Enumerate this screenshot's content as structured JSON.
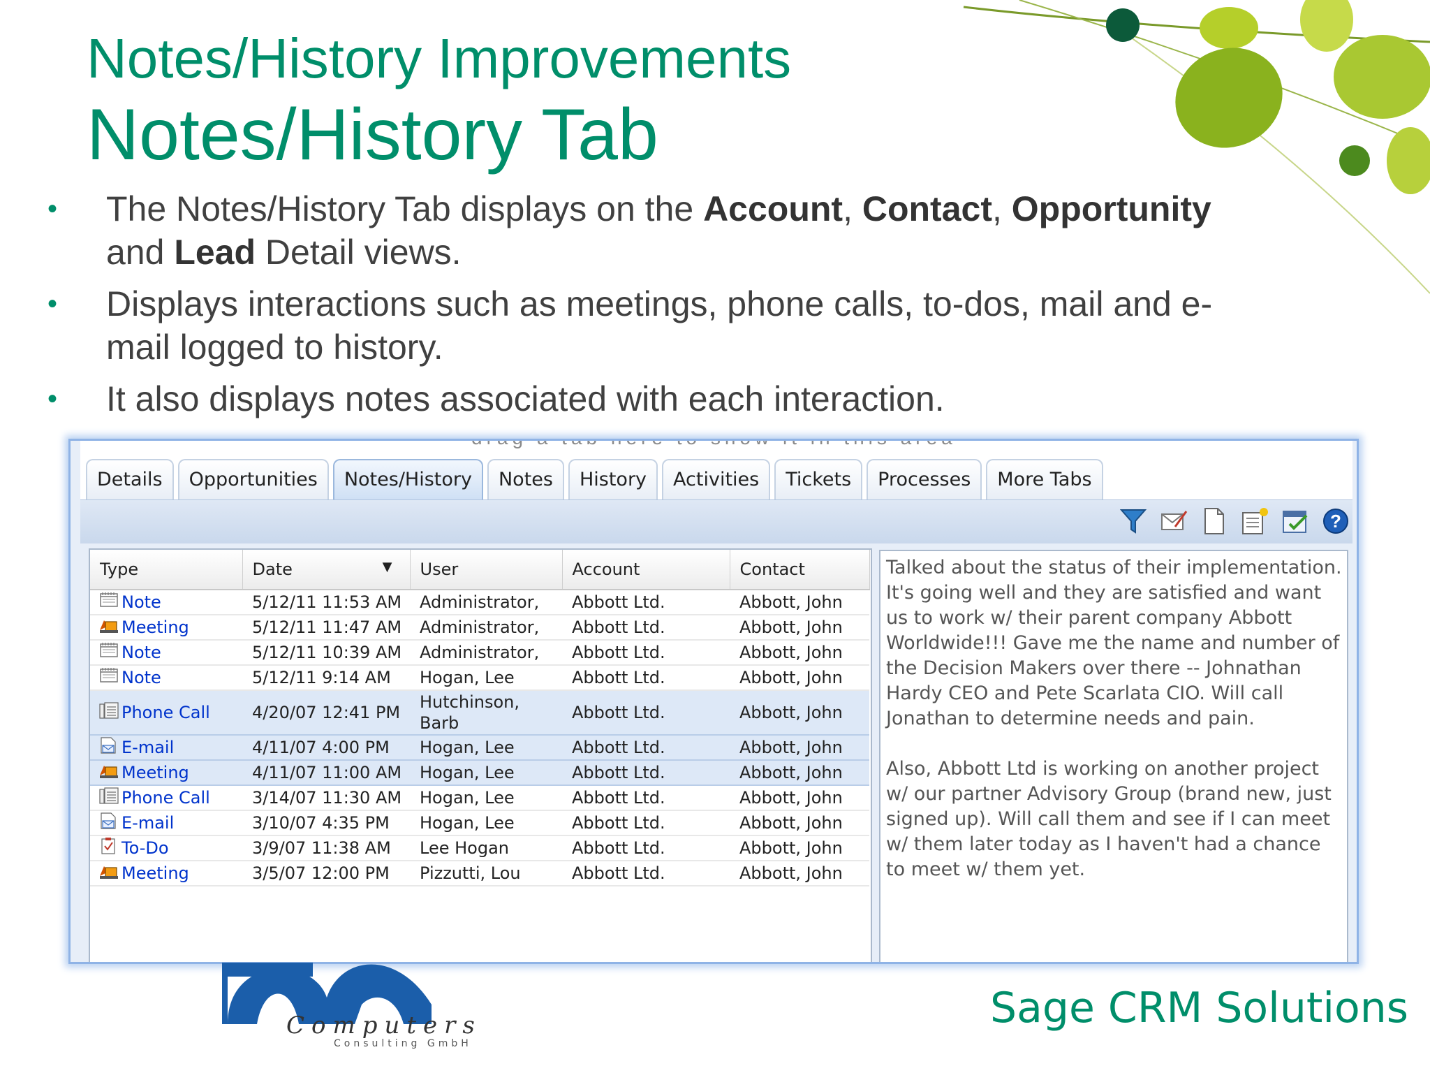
{
  "slide": {
    "title": "Notes/History Improvements",
    "subtitle": "Notes/History Tab",
    "bullets": [
      {
        "parts": [
          {
            "text": "The Notes/History Tab displays on the ",
            "bold": false
          },
          {
            "text": "Account",
            "bold": true
          },
          {
            "text": ", ",
            "bold": false
          },
          {
            "text": "Contact",
            "bold": true
          },
          {
            "text": ", ",
            "bold": false
          },
          {
            "text": "Opportunity",
            "bold": true
          },
          {
            "text": " and ",
            "bold": false
          },
          {
            "text": "Lead",
            "bold": true
          },
          {
            "text": " Detail views.",
            "bold": false
          }
        ]
      },
      {
        "parts": [
          {
            "text": "Displays interactions such as meetings, phone calls, to-dos, mail and e-mail logged to history.",
            "bold": false
          }
        ]
      },
      {
        "parts": [
          {
            "text": "It also displays notes associated with each interaction.",
            "bold": false
          }
        ]
      }
    ],
    "bullet_symbol": "•"
  },
  "crm": {
    "drag_hint": "drag a tab here to show it in this area",
    "tabs": [
      {
        "label": "Details",
        "active": false
      },
      {
        "label": "Opportunities",
        "active": false
      },
      {
        "label": "Notes/History",
        "active": true
      },
      {
        "label": "Notes",
        "active": false
      },
      {
        "label": "History",
        "active": false
      },
      {
        "label": "Activities",
        "active": false
      },
      {
        "label": "Tickets",
        "active": false
      },
      {
        "label": "Processes",
        "active": false
      },
      {
        "label": "More Tabs",
        "active": false
      }
    ],
    "toolbar_icons": [
      "filter-icon",
      "mark-mail-icon",
      "new-document-icon",
      "new-note-icon",
      "calendar-check-icon",
      "help-icon"
    ],
    "grid": {
      "columns": [
        "Type",
        "Date",
        "User",
        "Account",
        "Contact"
      ],
      "sorted_column": "Date",
      "rows": [
        {
          "type": "Note",
          "icon": "note-icon",
          "date": "5/12/11 11:53 AM",
          "user": "Administrator,",
          "account": "Abbott Ltd.",
          "contact": "Abbott, John",
          "selected": false
        },
        {
          "type": "Meeting",
          "icon": "meeting-icon",
          "date": "5/12/11 11:47 AM",
          "user": "Administrator,",
          "account": "Abbott Ltd.",
          "contact": "Abbott, John",
          "selected": false
        },
        {
          "type": "Note",
          "icon": "note-icon",
          "date": "5/12/11 10:39 AM",
          "user": "Administrator,",
          "account": "Abbott Ltd.",
          "contact": "Abbott, John",
          "selected": false
        },
        {
          "type": "Note",
          "icon": "note-icon",
          "date": "5/12/11 9:14 AM",
          "user": "Hogan, Lee",
          "account": "Abbott Ltd.",
          "contact": "Abbott, John",
          "selected": false
        },
        {
          "type": "Phone Call",
          "icon": "phone-icon",
          "date": "4/20/07 12:41 PM",
          "user": "Hutchinson, Barb",
          "account": "Abbott Ltd.",
          "contact": "Abbott, John",
          "selected": true
        },
        {
          "type": "E-mail",
          "icon": "email-icon",
          "date": "4/11/07 4:00 PM",
          "user": "Hogan, Lee",
          "account": "Abbott Ltd.",
          "contact": "Abbott, John",
          "selected": true
        },
        {
          "type": "Meeting",
          "icon": "meeting-icon",
          "date": "4/11/07 11:00 AM",
          "user": "Hogan, Lee",
          "account": "Abbott Ltd.",
          "contact": "Abbott, John",
          "selected": true
        },
        {
          "type": "Phone Call",
          "icon": "phone-icon",
          "date": "3/14/07 11:30 AM",
          "user": "Hogan, Lee",
          "account": "Abbott Ltd.",
          "contact": "Abbott, John",
          "selected": false
        },
        {
          "type": "E-mail",
          "icon": "email-icon",
          "date": "3/10/07 4:35 PM",
          "user": "Hogan, Lee",
          "account": "Abbott Ltd.",
          "contact": "Abbott, John",
          "selected": false
        },
        {
          "type": "To-Do",
          "icon": "todo-icon",
          "date": "3/9/07 11:38 AM",
          "user": "Lee Hogan",
          "account": "Abbott Ltd.",
          "contact": "Abbott, John",
          "selected": false
        },
        {
          "type": "Meeting",
          "icon": "meeting-icon",
          "date": "3/5/07 12:00 PM",
          "user": "Pizzutti, Lou",
          "account": "Abbott Ltd.",
          "contact": "Abbott, John",
          "selected": false
        }
      ]
    },
    "notes_text": [
      "Talked about the status of their implementation.  It's going well and they are satisfied and want us to work w/ their parent company Abbott Worldwide!!!  Gave me the name and number of the Decision Makers over there -- Johnathan Hardy CEO and Pete Scarlata CIO.  Will call Jonathan to determine needs and pain.",
      "Also, Abbott Ltd is working on another project w/ our partner Advisory Group (brand new, just signed up).  Will call them and see if I can meet w/ them later today as I haven't had a chance to meet w/ them yet."
    ]
  },
  "footer": {
    "logo_wordmark": "Computers",
    "logo_small": "Consulting GmbH",
    "brand": "Sage CRM Solutions"
  },
  "colors": {
    "accent": "#008e6a",
    "link": "#0033cc",
    "panel_border": "#8fb3e6",
    "selected_row": "#dde8f7"
  }
}
